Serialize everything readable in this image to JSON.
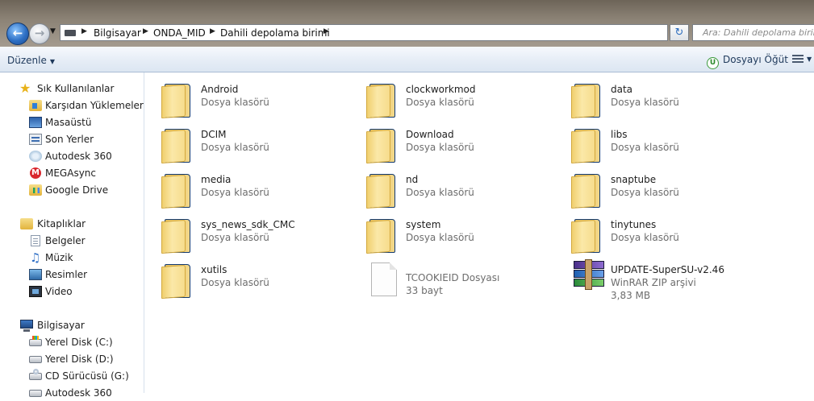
{
  "address": {
    "crumbs": [
      "Bilgisayar",
      "ONDA_MID",
      "Dahili depolama birimi"
    ],
    "search_placeholder": "Ara: Dahili depolama birimi"
  },
  "toolbar": {
    "organize_label": "Düzenle",
    "burn_label": "Dosyayı Öğüt"
  },
  "nav": {
    "favorites_label": "Sık Kullanılanlar",
    "favorites": [
      "Karşıdan Yüklemeler",
      "Masaüstü",
      "Son Yerler",
      "Autodesk 360",
      "MEGAsync",
      "Google Drive"
    ],
    "libraries_label": "Kitaplıklar",
    "libraries": [
      "Belgeler",
      "Müzik",
      "Resimler",
      "Video"
    ],
    "computer_label": "Bilgisayar",
    "computer": [
      "Yerel Disk (C:)",
      "Yerel Disk (D:)",
      "CD Sürücüsü (G:)",
      "Autodesk 360"
    ]
  },
  "files": [
    {
      "name": "Android",
      "type": "Dosya klasörü",
      "kind": "folder"
    },
    {
      "name": "clockworkmod",
      "type": "Dosya klasörü",
      "kind": "folder"
    },
    {
      "name": "data",
      "type": "Dosya klasörü",
      "kind": "folder"
    },
    {
      "name": "DCIM",
      "type": "Dosya klasörü",
      "kind": "folder"
    },
    {
      "name": "Download",
      "type": "Dosya klasörü",
      "kind": "folder"
    },
    {
      "name": "libs",
      "type": "Dosya klasörü",
      "kind": "folder"
    },
    {
      "name": "media",
      "type": "Dosya klasörü",
      "kind": "folder"
    },
    {
      "name": "nd",
      "type": "Dosya klasörü",
      "kind": "folder"
    },
    {
      "name": "snaptube",
      "type": "Dosya klasörü",
      "kind": "folder"
    },
    {
      "name": "sys_news_sdk_CMC",
      "type": "Dosya klasörü",
      "kind": "folder"
    },
    {
      "name": "system",
      "type": "Dosya klasörü",
      "kind": "folder"
    },
    {
      "name": "tinytunes",
      "type": "Dosya klasörü",
      "kind": "folder"
    },
    {
      "name": "xutils",
      "type": "Dosya klasörü",
      "kind": "folder"
    },
    {
      "name": "TCOOKIEID",
      "type": "TCOOKIEID Dosyası",
      "size": "33 bayt",
      "kind": "file"
    },
    {
      "name": "UPDATE-SuperSU-v2.46",
      "type": "WinRAR ZIP arşivi",
      "size": "3,83 MB",
      "kind": "rar"
    }
  ]
}
